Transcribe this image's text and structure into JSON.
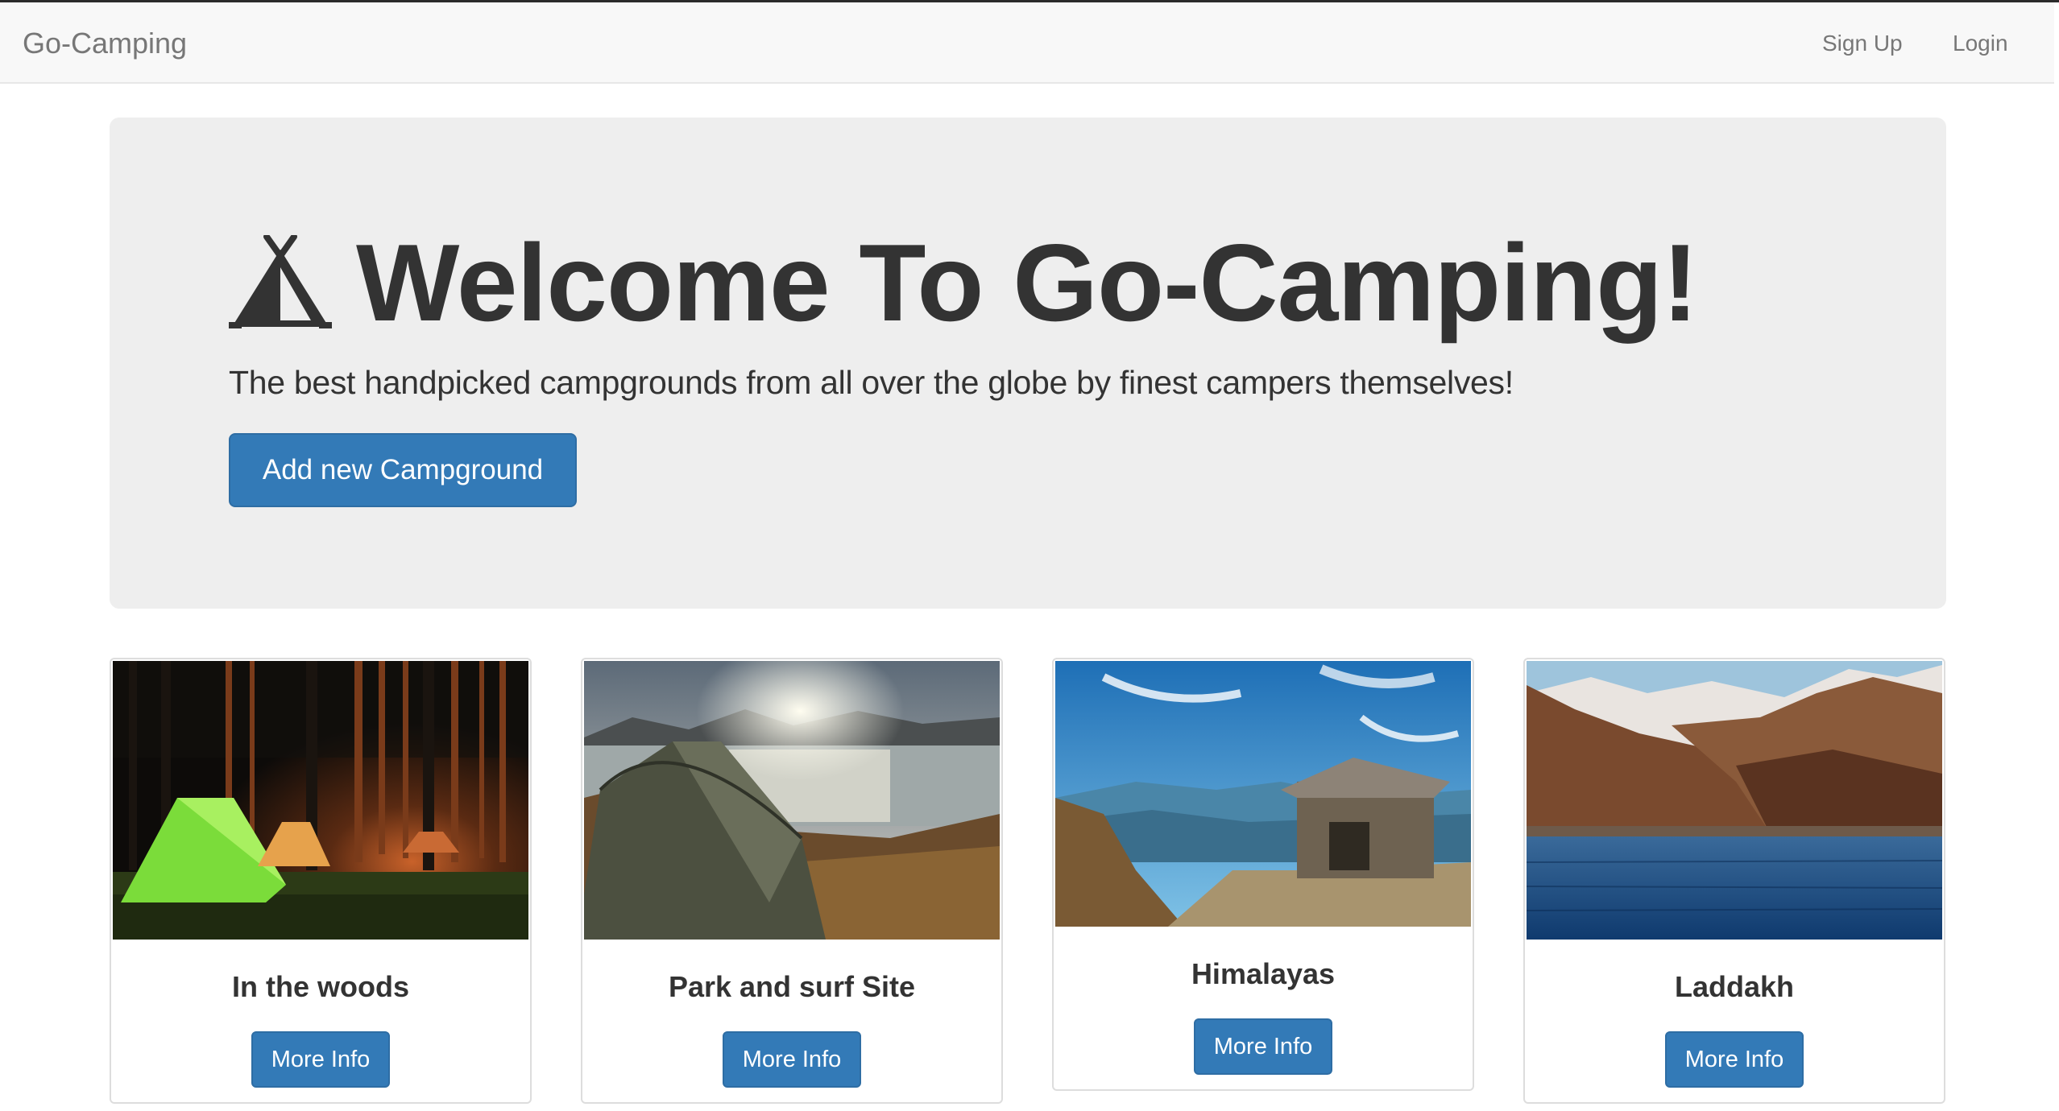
{
  "navbar": {
    "brand": "Go-Camping",
    "links": {
      "signup": "Sign Up",
      "login": "Login"
    }
  },
  "hero": {
    "icon": "tent-icon",
    "title": "Welcome To Go-Camping!",
    "subtitle": "The best handpicked campgrounds from all over the globe by finest campers themselves!",
    "button_label": "Add new Campground"
  },
  "campgrounds": [
    {
      "name": "In the woods",
      "button_label": "More Info",
      "image": "night-forest-tents-photo"
    },
    {
      "name": "Park and surf Site",
      "button_label": "More Info",
      "image": "lakeside-tent-sunset-photo"
    },
    {
      "name": "Himalayas",
      "button_label": "More Info",
      "image": "mountain-stone-hut-photo"
    },
    {
      "name": "Laddakh",
      "button_label": "More Info",
      "image": "mountain-lake-photo"
    }
  ],
  "colors": {
    "primary": "#337ab7",
    "navbar_bg": "#f8f8f8",
    "jumbotron_bg": "#eeeeee",
    "text": "#333333",
    "nav_text": "#777777"
  }
}
